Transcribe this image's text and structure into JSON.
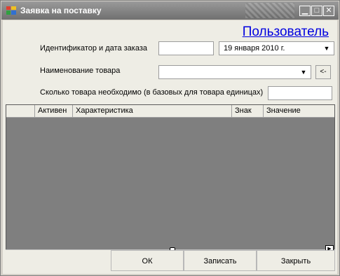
{
  "window": {
    "title": "Заявка на поставку",
    "minimize_glyph": "▁",
    "maximize_glyph": "□",
    "close_glyph": "✕"
  },
  "user_link": "Пользователь",
  "form": {
    "order_label": "Идентификатор и дата заказа",
    "order_id_value": "",
    "order_date_value": "19  января  2010 г.",
    "product_label": "Наименование товара",
    "product_value": "",
    "product_button_label": "<-",
    "quantity_label": "Сколько товара необходимо (в базовых для товара единицах)",
    "quantity_value": ""
  },
  "grid": {
    "columns": [
      "Активен",
      "Характеристика",
      "Знак",
      "Значение"
    ],
    "rows": []
  },
  "buttons": {
    "ok": "ОК",
    "save": "Записать",
    "close": "Закрыть"
  },
  "icons": {
    "dropdown": "chevron-down-icon",
    "scroll_right": "scroll-right-arrow-icon"
  }
}
